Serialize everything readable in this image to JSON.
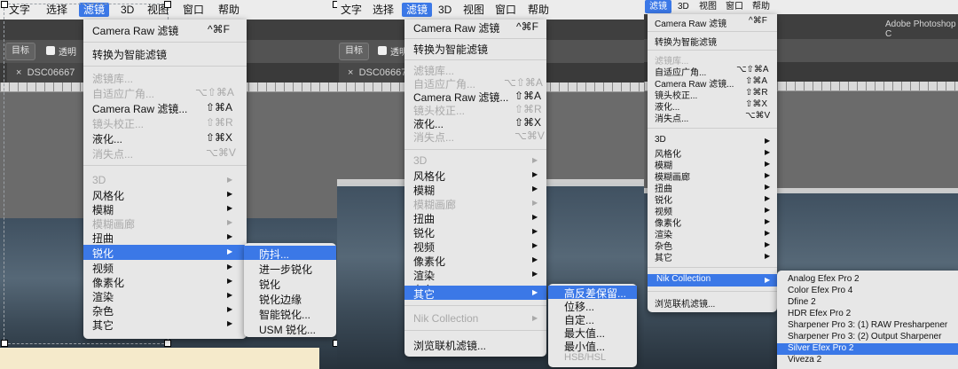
{
  "panel1": {
    "menubar": [
      "文字",
      "选择",
      "滤镜",
      "3D",
      "视图",
      "窗口",
      "帮助"
    ],
    "optbar": {
      "button": "目标",
      "checkbox": "透明"
    },
    "tab": "DSC06667",
    "menu": {
      "items": [
        {
          "label": "Camera Raw 滤镜",
          "shortcut": "^⌘F"
        },
        {
          "label": "转换为智能滤镜"
        },
        {
          "label": "滤镜库..."
        },
        {
          "label": "自适应广角...",
          "shortcut": "⌥⇧⌘A"
        },
        {
          "label": "Camera Raw 滤镜...",
          "shortcut": "⇧⌘A"
        },
        {
          "label": "镜头校正...",
          "shortcut": "⇧⌘R"
        },
        {
          "label": "液化...",
          "shortcut": "⇧⌘X"
        },
        {
          "label": "消失点...",
          "shortcut": "⌥⌘V"
        },
        {
          "label": "3D"
        },
        {
          "label": "风格化"
        },
        {
          "label": "模糊"
        },
        {
          "label": "模糊画廊"
        },
        {
          "label": "扭曲"
        },
        {
          "label": "锐化"
        },
        {
          "label": "视频"
        },
        {
          "label": "像素化"
        },
        {
          "label": "渲染"
        },
        {
          "label": "杂色"
        },
        {
          "label": "其它"
        }
      ]
    },
    "submenu": [
      "防抖...",
      "进一步锐化",
      "锐化",
      "锐化边缘",
      "智能锐化...",
      "USM 锐化..."
    ]
  },
  "panel2": {
    "menubar": [
      "文字",
      "选择",
      "滤镜",
      "3D",
      "视图",
      "窗口",
      "帮助"
    ],
    "optbar": {
      "button": "目标",
      "checkbox": "透明"
    },
    "tab": "DSC06667",
    "menu": {
      "items": [
        {
          "label": "Camera Raw 滤镜",
          "shortcut": "^⌘F"
        },
        {
          "label": "转换为智能滤镜"
        },
        {
          "label": "滤镜库..."
        },
        {
          "label": "自适应广角...",
          "shortcut": "⌥⇧⌘A"
        },
        {
          "label": "Camera Raw 滤镜...",
          "shortcut": "⇧⌘A"
        },
        {
          "label": "镜头校正...",
          "shortcut": "⇧⌘R"
        },
        {
          "label": "液化...",
          "shortcut": "⇧⌘X"
        },
        {
          "label": "消失点...",
          "shortcut": "⌥⌘V"
        },
        {
          "label": "3D"
        },
        {
          "label": "风格化"
        },
        {
          "label": "模糊"
        },
        {
          "label": "模糊画廊"
        },
        {
          "label": "扭曲"
        },
        {
          "label": "锐化"
        },
        {
          "label": "视频"
        },
        {
          "label": "像素化"
        },
        {
          "label": "渲染"
        },
        {
          "label": "杂色"
        },
        {
          "label": "其它"
        },
        {
          "label": "Nik Collection"
        },
        {
          "label": "浏览联机滤镜..."
        }
      ]
    },
    "submenu": [
      "高反差保留...",
      "位移...",
      "自定...",
      "最大值...",
      "最小值...",
      "HSB/HSL"
    ]
  },
  "panel3": {
    "menubar": [
      "滤镜",
      "3D",
      "视图",
      "窗口",
      "帮助"
    ],
    "app_title": "Adobe Photoshop C",
    "menu": {
      "items": [
        {
          "label": "Camera Raw 滤镜",
          "shortcut": "^⌘F"
        },
        {
          "label": "转换为智能滤镜"
        },
        {
          "label": "滤镜库..."
        },
        {
          "label": "自适应广角...",
          "shortcut": "⌥⇧⌘A"
        },
        {
          "label": "Camera Raw 滤镜...",
          "shortcut": "⇧⌘A"
        },
        {
          "label": "镜头校正...",
          "shortcut": "⇧⌘R"
        },
        {
          "label": "液化...",
          "shortcut": "⇧⌘X"
        },
        {
          "label": "消失点...",
          "shortcut": "⌥⌘V"
        },
        {
          "label": "3D"
        },
        {
          "label": "风格化"
        },
        {
          "label": "模糊"
        },
        {
          "label": "模糊画廊"
        },
        {
          "label": "扭曲"
        },
        {
          "label": "锐化"
        },
        {
          "label": "视频"
        },
        {
          "label": "像素化"
        },
        {
          "label": "渲染"
        },
        {
          "label": "杂色"
        },
        {
          "label": "其它"
        },
        {
          "label": "Nik Collection"
        },
        {
          "label": "浏览联机滤镜..."
        }
      ]
    },
    "submenu": [
      "Analog Efex Pro 2",
      "Color Efex Pro 4",
      "Dfine 2",
      "HDR Efex Pro 2",
      "Sharpener Pro 3: (1) RAW Presharpener",
      "Sharpener Pro 3: (2) Output Sharpener",
      "Silver Efex Pro 2",
      "Viveza 2"
    ]
  },
  "colors": {
    "highlight": "#3b78e7",
    "menu_bg": "#e7e7e7",
    "disabled": "#a9a9a9"
  },
  "icons": {
    "submenu_arrow": "▶"
  }
}
